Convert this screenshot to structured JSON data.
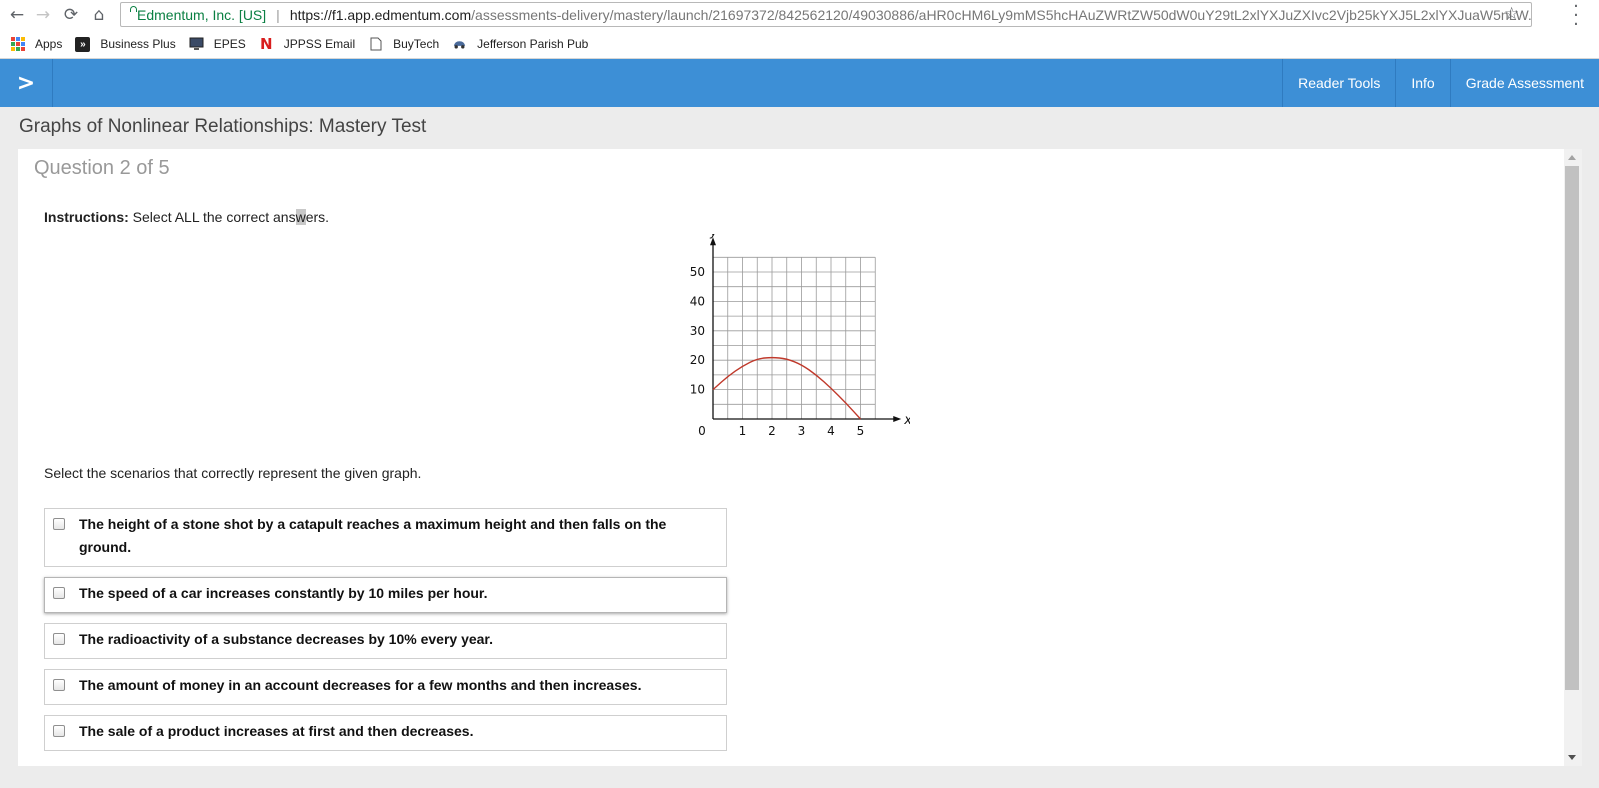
{
  "browser": {
    "site_identity": "Edmentum, Inc. [US]",
    "url_host": "https://f1.app.edmentum.com",
    "url_path": "/assessments-delivery/mastery/launch/21697372/842562120/49030886/aHR0cHM6Ly9mMS5hcHAuZWRtZW50dW0uY29tL2xlYXJuZXIvc2Vjb25kYXJ5L2xlYXJuaW5nLW...",
    "bookmarks": [
      {
        "label": "Apps",
        "icon": "apps-grid-icon"
      },
      {
        "label": "Business Plus",
        "icon": "business-plus-icon"
      },
      {
        "label": "EPES",
        "icon": "monitor-icon"
      },
      {
        "label": "JPPSS Email",
        "icon": "n-logo-icon"
      },
      {
        "label": "BuyTech",
        "icon": "page-icon"
      },
      {
        "label": "Jefferson Parish Pub",
        "icon": "car-icon"
      }
    ]
  },
  "header": {
    "nav": [
      "Reader Tools",
      "Info",
      "Grade Assessment"
    ]
  },
  "page": {
    "title": "Graphs of Nonlinear Relationships: Mastery Test",
    "question_counter": "Question 2 of 5",
    "instructions_label": "Instructions:",
    "instructions_text_before": " Select ALL the correct ans",
    "instructions_text_highlight": "w",
    "instructions_text_after": "ers.",
    "prompt": "Select the scenarios that correctly represent the given graph."
  },
  "options": [
    {
      "label": "The height of a stone shot by a catapult reaches a maximum height and then falls on the ground.",
      "checked": false
    },
    {
      "label": "The speed of a car increases constantly by 10 miles per hour.",
      "checked": false
    },
    {
      "label": "The radioactivity of a substance decreases by 10% every year.",
      "checked": false
    },
    {
      "label": "The amount of money in an account decreases for a few months and then increases.",
      "checked": false
    },
    {
      "label": "The sale of a product increases at first and then decreases.",
      "checked": false
    }
  ],
  "chart_data": {
    "type": "line",
    "xlabel": "x",
    "ylabel": "y",
    "xlim": [
      0,
      5.5
    ],
    "ylim": [
      0,
      55
    ],
    "x_ticks": [
      "1",
      "2",
      "3",
      "4",
      "5"
    ],
    "y_ticks": [
      "10",
      "20",
      "30",
      "40",
      "50"
    ],
    "origin_label": "0",
    "grid": true,
    "series": [
      {
        "color": "#c0392b",
        "x": [
          0,
          0.5,
          1,
          1.5,
          2,
          2.5,
          3,
          3.5,
          4,
          4.5,
          5
        ],
        "y": [
          10,
          14.5,
          18,
          20.5,
          21,
          20.5,
          18.5,
          15,
          10.5,
          5.5,
          0
        ]
      }
    ]
  }
}
